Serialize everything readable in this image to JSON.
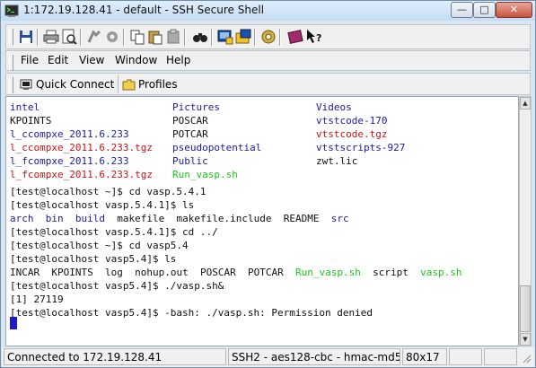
{
  "window": {
    "title": "1:172.19.128.41 - default - SSH Secure Shell",
    "controls": {
      "minimize": "—",
      "maximize": "□",
      "close": "✕"
    }
  },
  "toolbar": {
    "icons": [
      "save-icon",
      "print-icon",
      "print-preview-icon",
      "disconnect-icon",
      "settings-icon",
      "copy-icon",
      "paste-icon",
      "paste-alt-icon",
      "find-icon",
      "new-terminal-icon",
      "file-transfer-icon",
      "profiles-settings-icon",
      "help-book-icon",
      "context-help-icon"
    ]
  },
  "menu": {
    "file": "File",
    "edit": "Edit",
    "view": "View",
    "window": "Window",
    "help": "Help"
  },
  "quickbar": {
    "quick_connect": "Quick Connect",
    "profiles": "Profiles"
  },
  "colors": {
    "dir": "#1a1aa8",
    "archive": "#c81414",
    "exec": "#18c818",
    "text": "#101010",
    "cursor": "#1a1ad0"
  },
  "terminal": {
    "ls_grid": [
      [
        {
          "t": "intel",
          "c": "blue"
        },
        {
          "t": "Pictures",
          "c": "blue"
        },
        {
          "t": "Videos",
          "c": "blue"
        }
      ],
      [
        {
          "t": "KPOINTS",
          "c": "plain"
        },
        {
          "t": "POSCAR",
          "c": "plain"
        },
        {
          "t": "vtstcode-170",
          "c": "blue"
        }
      ],
      [
        {
          "t": "l_ccompxe_2011.6.233",
          "c": "blue"
        },
        {
          "t": "POTCAR",
          "c": "plain"
        },
        {
          "t": "vtstcode.tgz",
          "c": "red"
        }
      ],
      [
        {
          "t": "l_ccompxe_2011.6.233.tgz",
          "c": "red"
        },
        {
          "t": "pseudopotential",
          "c": "blue"
        },
        {
          "t": "vtstscripts-927",
          "c": "blue"
        }
      ],
      [
        {
          "t": "l_fcompxe_2011.6.233",
          "c": "blue"
        },
        {
          "t": "Public",
          "c": "blue"
        },
        {
          "t": "zwt.lic",
          "c": "plain"
        }
      ],
      [
        {
          "t": "l_fcompxe_2011.6.233.tgz",
          "c": "red"
        },
        {
          "t": "Run_vasp.sh",
          "c": "green"
        },
        {
          "t": "",
          "c": "plain"
        }
      ]
    ],
    "line_cd1": "[test@localhost ~]$ cd vasp.5.4.1",
    "line_ls1": "[test@localhost vasp.5.4.1]$ ls",
    "ls1_items": [
      {
        "t": "arch",
        "c": "blue"
      },
      {
        "t": "bin",
        "c": "blue"
      },
      {
        "t": "build",
        "c": "blue"
      },
      {
        "t": "makefile",
        "c": "plain"
      },
      {
        "t": "makefile.include",
        "c": "plain"
      },
      {
        "t": "README",
        "c": "plain"
      },
      {
        "t": "src",
        "c": "blue"
      }
    ],
    "line_cd2": "[test@localhost vasp.5.4.1]$ cd ../",
    "line_cd3": "[test@localhost ~]$ cd vasp5.4",
    "line_ls2": "[test@localhost vasp5.4]$ ls",
    "ls2_items": [
      {
        "t": "INCAR",
        "c": "plain"
      },
      {
        "t": "KPOINTS",
        "c": "plain"
      },
      {
        "t": "log",
        "c": "plain"
      },
      {
        "t": "nohup.out",
        "c": "plain"
      },
      {
        "t": "POSCAR",
        "c": "plain"
      },
      {
        "t": "POTCAR",
        "c": "plain"
      },
      {
        "t": "Run_vasp.sh",
        "c": "green"
      },
      {
        "t": "script",
        "c": "plain"
      },
      {
        "t": "vasp.sh",
        "c": "green"
      }
    ],
    "line_run": "[test@localhost vasp5.4]$ ./vasp.sh&",
    "line_job": "[1] 27119",
    "line_err": "[test@localhost vasp5.4]$ -bash: ./vasp.sh: Permission denied"
  },
  "status": {
    "connection": "Connected to 172.19.128.41",
    "protocol": "SSH2 - aes128-cbc - hmac-md5",
    "size": "80x17"
  }
}
